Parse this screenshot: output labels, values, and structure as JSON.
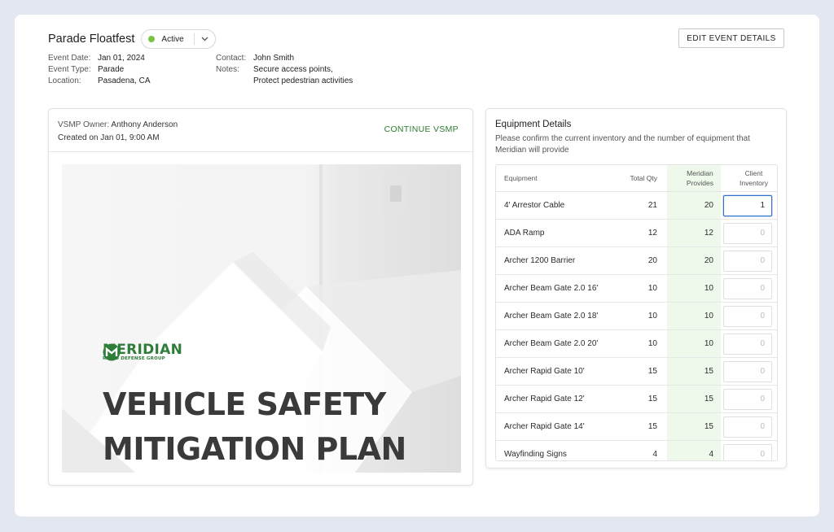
{
  "event": {
    "title": "Parade Floatfest",
    "status": "Active",
    "edit_button": "EDIT EVENT DETAILS",
    "details_left": [
      {
        "label": "Event Date:",
        "value": "Jan 01, 2024"
      },
      {
        "label": "Event Type:",
        "value": "Parade"
      },
      {
        "label": "Location:",
        "value": "Pasadena, CA"
      }
    ],
    "contact_label": "Contact:",
    "contact_value": "John Smith",
    "notes_label": "Notes:",
    "notes_lines": [
      "Secure access points,",
      "Protect pedestrian activities"
    ]
  },
  "vsmp": {
    "owner_label": "VSMP Owner:",
    "owner_value": "Anthony Anderson",
    "created": "Created on Jan 01, 9:00 AM",
    "continue_label": "CONTINUE VSMP",
    "cover": {
      "logo_name": "MERIDIAN",
      "logo_sub": "RAPID DEFENSE GROUP",
      "title_line1": "VEHICLE SAFETY",
      "title_line2": "MITIGATION PLAN"
    }
  },
  "equipment": {
    "title": "Equipment Details",
    "description": "Please confirm the current inventory and the number of equipment that Meridian will provide",
    "columns": {
      "equipment": "Equipment",
      "total": "Total Qty",
      "provides_line1": "Meridian",
      "provides_line2": "Provides",
      "client_line1": "Client",
      "client_line2": "Inventory"
    },
    "rows": [
      {
        "name": "4' Arrestor Cable",
        "total": "21",
        "provides": "20",
        "client": "1"
      },
      {
        "name": "ADA Ramp",
        "total": "12",
        "provides": "12",
        "client": "0"
      },
      {
        "name": "Archer 1200 Barrier",
        "total": "20",
        "provides": "20",
        "client": "0"
      },
      {
        "name": "Archer Beam Gate 2.0 16'",
        "total": "10",
        "provides": "10",
        "client": "0"
      },
      {
        "name": "Archer Beam Gate 2.0 18'",
        "total": "10",
        "provides": "10",
        "client": "0"
      },
      {
        "name": "Archer Beam Gate 2.0 20'",
        "total": "10",
        "provides": "10",
        "client": "0"
      },
      {
        "name": "Archer Rapid Gate 10'",
        "total": "15",
        "provides": "15",
        "client": "0"
      },
      {
        "name": "Archer Rapid Gate 12'",
        "total": "15",
        "provides": "15",
        "client": "0"
      },
      {
        "name": "Archer Rapid Gate 14'",
        "total": "15",
        "provides": "15",
        "client": "0"
      },
      {
        "name": "Wayfinding Signs",
        "total": "4",
        "provides": "4",
        "client": "0"
      }
    ]
  },
  "colors": {
    "accent_green": "#2e7d32",
    "status_active": "#7cc343",
    "provides_bg": "#eef9ec",
    "focus_blue": "#2f6fcf"
  }
}
